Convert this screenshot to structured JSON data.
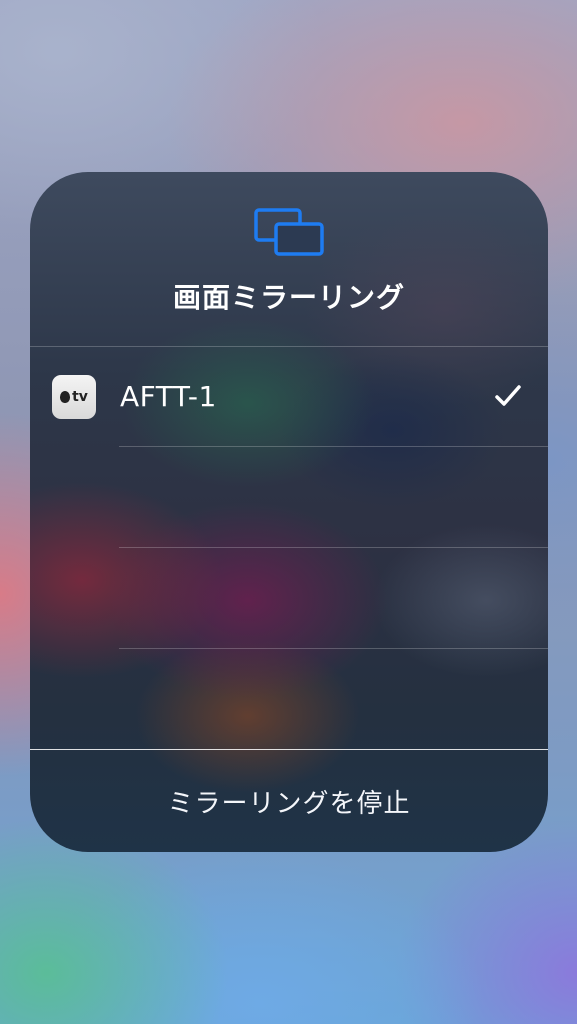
{
  "dialog": {
    "title": "画面ミラーリング",
    "icon": "screen-mirroring-icon",
    "accent_color": "#1e7cf2"
  },
  "devices": [
    {
      "name": "AFTT-1",
      "icon": "apple-tv-icon",
      "icon_label": "tv",
      "selected": true
    }
  ],
  "stop_button": {
    "label": "ミラーリングを停止"
  },
  "colors": {
    "text": "#ffffff",
    "divider": "rgba(255,255,255,0.22)"
  }
}
